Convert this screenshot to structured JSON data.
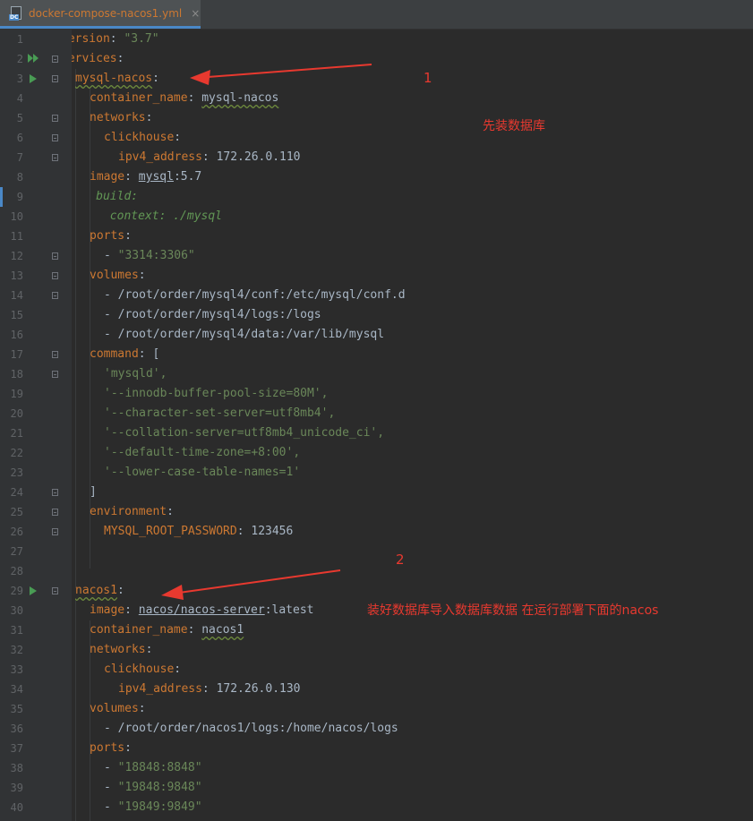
{
  "tab": {
    "filename": "docker-compose-nacos1.yml",
    "file_icon": "docker-compose-file-icon",
    "icon_badge": "DC",
    "close_glyph": "×"
  },
  "line_numbers": [
    "1",
    "2",
    "3",
    "4",
    "5",
    "6",
    "7",
    "8",
    "9",
    "10",
    "11",
    "12",
    "13",
    "14",
    "15",
    "16",
    "17",
    "18",
    "19",
    "20",
    "21",
    "22",
    "23",
    "24",
    "25",
    "26",
    "27",
    "28",
    "29",
    "30",
    "31",
    "32",
    "33",
    "34",
    "35",
    "36",
    "37",
    "38",
    "39",
    "40"
  ],
  "code": {
    "l1_key": "version",
    "l1_val": "\"3.7\"",
    "l2_key": "services",
    "l3_key": "mysql-nacos",
    "l4_key": "container_name",
    "l4_val": "mysql-nacos",
    "l5_key": "networks",
    "l6_key": "clickhouse",
    "l7_key": "ipv4_address",
    "l7_val": "172.26.0.110",
    "l8_key": "image",
    "l8_val_a": "mysql",
    "l8_val_b": ":5.7",
    "l9_comment": "#    build:",
    "l10_comment": "#      context: ./mysql",
    "l11_key": "ports",
    "l12_val": "\"3314:3306\"",
    "l13_key": "volumes",
    "l14_val": "/root/order/mysql4/conf:/etc/mysql/conf.d",
    "l15_val": "/root/order/mysql4/logs:/logs",
    "l16_val": "/root/order/mysql4/data:/var/lib/mysql",
    "l17_key": "command",
    "l17_val": "[",
    "l18_val": "'mysqld',",
    "l19_val": "'--innodb-buffer-pool-size=80M',",
    "l20_val": "'--character-set-server=utf8mb4',",
    "l21_val": "'--collation-server=utf8mb4_unicode_ci',",
    "l22_val": "'--default-time-zone=+8:00',",
    "l23_val": "'--lower-case-table-names=1'",
    "l24_val": "]",
    "l25_key": "environment",
    "l26_key": "MYSQL_ROOT_PASSWORD",
    "l26_val": "123456",
    "l29_key": "nacos1",
    "l30_key": "image",
    "l30_val_a": "nacos/nacos-server",
    "l30_val_b": ":latest",
    "l31_key": "container_name",
    "l31_val": "nacos1",
    "l32_key": "networks",
    "l33_key": "clickhouse",
    "l34_key": "ipv4_address",
    "l34_val": "172.26.0.130",
    "l35_key": "volumes",
    "l36_val": "/root/order/nacos1/logs:/home/nacos/logs",
    "l37_key": "ports",
    "l38_val": "\"18848:8848\"",
    "l39_val": "\"19848:9848\"",
    "l40_val": "\"19849:9849\""
  },
  "annotations": {
    "step1_number": "1",
    "step1_text": "先装数据库",
    "step2_number": "2",
    "step2_text": "装好数据库导入数据库数据 在运行部署下面的nacos"
  },
  "colors": {
    "annotation": "#e8392f",
    "keyword": "#cc7832",
    "string": "#6a8759",
    "comment": "#629755",
    "background": "#2b2b2b"
  }
}
